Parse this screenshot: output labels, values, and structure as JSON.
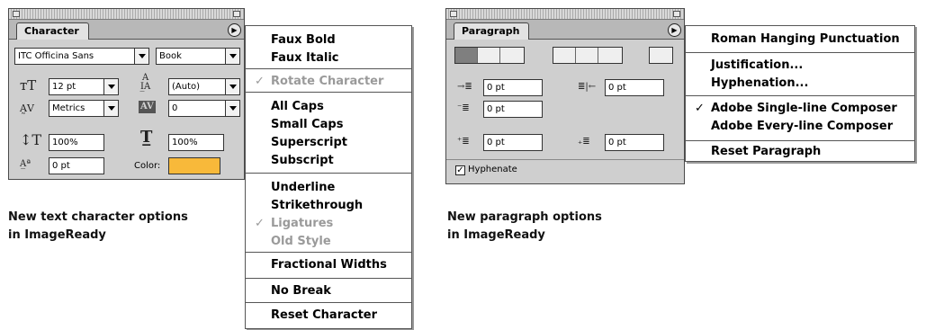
{
  "character_panel": {
    "tab_label": "Character",
    "font_family": "ITC Officina Sans",
    "font_style": "Book",
    "size": "12 pt",
    "leading": "(Auto)",
    "kerning": "Metrics",
    "tracking": "0",
    "vertical_scale": "100%",
    "horizontal_scale": "100%",
    "baseline_shift": "0 pt",
    "color_label": "Color:",
    "color_value": "#f8b93a",
    "menu_icon": "panel-menu-arrow-icon"
  },
  "character_menu": {
    "items": [
      {
        "label": "Faux Bold",
        "checked": false,
        "disabled": false
      },
      {
        "label": "Faux Italic",
        "checked": false,
        "disabled": false
      },
      {
        "label": "Rotate Character",
        "checked": true,
        "disabled": true
      },
      {
        "label": "All Caps",
        "checked": false,
        "disabled": false
      },
      {
        "label": "Small Caps",
        "checked": false,
        "disabled": false
      },
      {
        "label": "Superscript",
        "checked": false,
        "disabled": false
      },
      {
        "label": "Subscript",
        "checked": false,
        "disabled": false
      },
      {
        "label": "Underline",
        "checked": false,
        "disabled": false
      },
      {
        "label": "Strikethrough",
        "checked": false,
        "disabled": false
      },
      {
        "label": "Ligatures",
        "checked": true,
        "disabled": true
      },
      {
        "label": "Old Style",
        "checked": false,
        "disabled": true
      },
      {
        "label": "Fractional Widths",
        "checked": false,
        "disabled": false
      },
      {
        "label": "No Break",
        "checked": false,
        "disabled": false
      },
      {
        "label": "Reset Character",
        "checked": false,
        "disabled": false
      }
    ],
    "check_glyph": "✓"
  },
  "paragraph_panel": {
    "tab_label": "Paragraph",
    "indent_left": "0 pt",
    "indent_right": "0 pt",
    "indent_first_line": "0 pt",
    "space_before": "0 pt",
    "space_after": "0 pt",
    "hyphenate_label": "Hyphenate",
    "hyphenate_checked": true,
    "menu_icon": "panel-menu-arrow-icon"
  },
  "paragraph_menu": {
    "items": [
      {
        "label": "Roman Hanging Punctuation",
        "checked": false
      },
      {
        "label": "Justification...",
        "checked": false
      },
      {
        "label": "Hyphenation...",
        "checked": false
      },
      {
        "label": "Adobe Single-line Composer",
        "checked": true
      },
      {
        "label": "Adobe Every-line Composer",
        "checked": false
      },
      {
        "label": "Reset Paragraph",
        "checked": false
      }
    ],
    "check_glyph": "✓"
  },
  "captions": {
    "character_line1": "New text character options",
    "character_line2": "in ImageReady",
    "paragraph_line1": "New paragraph options",
    "paragraph_line2": "in ImageReady"
  }
}
